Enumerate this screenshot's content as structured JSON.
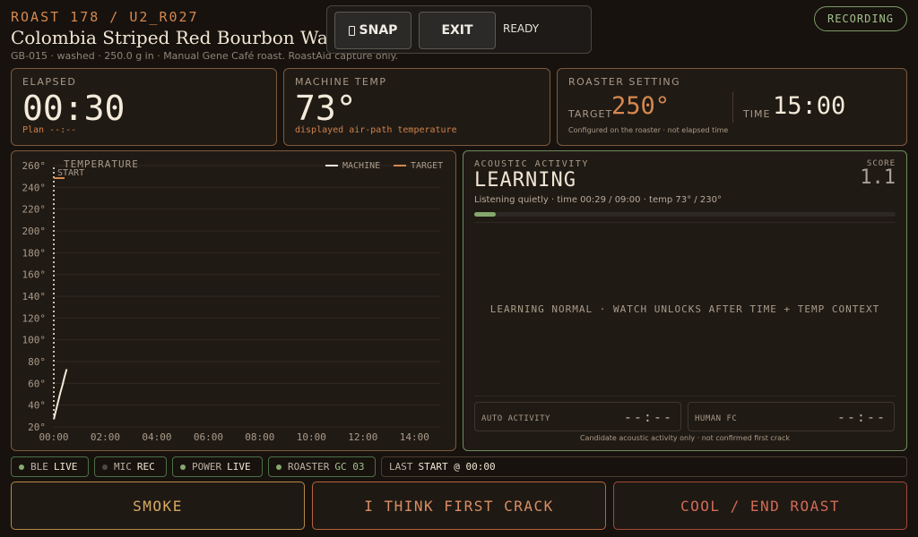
{
  "header": {
    "roast_id": "ROAST 178 / U2_R027",
    "bean_name": "Colombia Striped Red Bourbon Washed",
    "bean_meta": "GB-015 · washed · 250.0 g in · Manual Gene Café roast. RoastAid capture only."
  },
  "toolbar": {
    "snap_label": "SNAP",
    "exit_label": "EXIT",
    "status": "READY"
  },
  "recording": "RECORDING",
  "elapsed": {
    "label": "ELAPSED",
    "value": "00:30",
    "plan": "Plan --:--"
  },
  "machine": {
    "label": "MACHINE TEMP",
    "value": "73°",
    "note": "displayed air-path temperature"
  },
  "setting": {
    "label": "ROASTER SETTING",
    "target_label": "TARGET",
    "target_value": "250°",
    "time_label": "TIME",
    "time_value": "15:00",
    "note": "Configured on the roaster · not elapsed time"
  },
  "chart_data": {
    "type": "line",
    "title": "TEMPERATURE",
    "x_tick_labels": [
      "00:00",
      "02:00",
      "04:00",
      "06:00",
      "08:00",
      "10:00",
      "12:00",
      "14:00"
    ],
    "y_tick_labels": [
      "260°",
      "240°",
      "220°",
      "200°",
      "180°",
      "160°",
      "140°",
      "120°",
      "100°",
      "80°",
      "60°",
      "40°",
      "20°"
    ],
    "xlim_seconds": [
      0,
      900
    ],
    "ylim": [
      20,
      260
    ],
    "grid": true,
    "legend_position": "top-right",
    "annotation": "START",
    "start_marker_seconds": 0,
    "series": [
      {
        "name": "MACHINE",
        "color": "#f2ead8",
        "x_seconds": [
          0,
          5,
          10,
          15,
          20,
          25,
          30
        ],
        "values": [
          27,
          35,
          43,
          51,
          58,
          66,
          73
        ]
      },
      {
        "name": "TARGET",
        "color": "#d5884f",
        "x_seconds": [],
        "values": []
      }
    ]
  },
  "acoustic": {
    "title": "ACOUSTIC ACTIVITY",
    "state": "LEARNING",
    "score_label": "SCORE",
    "score_value": "1.1",
    "detail": "Listening quietly · time 00:29 / 09:00 · temp 73° / 230°",
    "progress_fraction": 0.05,
    "center_message": "LEARNING NORMAL · WATCH UNLOCKS AFTER TIME + TEMP CONTEXT",
    "auto_label": "AUTO ACTIVITY",
    "auto_value": "--:--",
    "human_label": "HUMAN FC",
    "human_value": "--:--",
    "footnote": "Candidate acoustic activity only · not confirmed first crack"
  },
  "status": {
    "ble": {
      "label": "BLE",
      "value": "LIVE",
      "dot": "#86a86f"
    },
    "mic": {
      "label": "MIC",
      "value": "REC",
      "dot": "#4b4a40"
    },
    "power": {
      "label": "POWER",
      "value": "LIVE",
      "dot": "#86a86f"
    },
    "roaster": {
      "label": "ROASTER",
      "value": "GC 03",
      "dot": "#86a86f"
    },
    "last_label": "LAST",
    "last_value": "START @ 00:00"
  },
  "actions": {
    "smoke": "SMOKE",
    "first_crack": "I THINK FIRST CRACK",
    "cool": "COOL / END ROAST"
  }
}
